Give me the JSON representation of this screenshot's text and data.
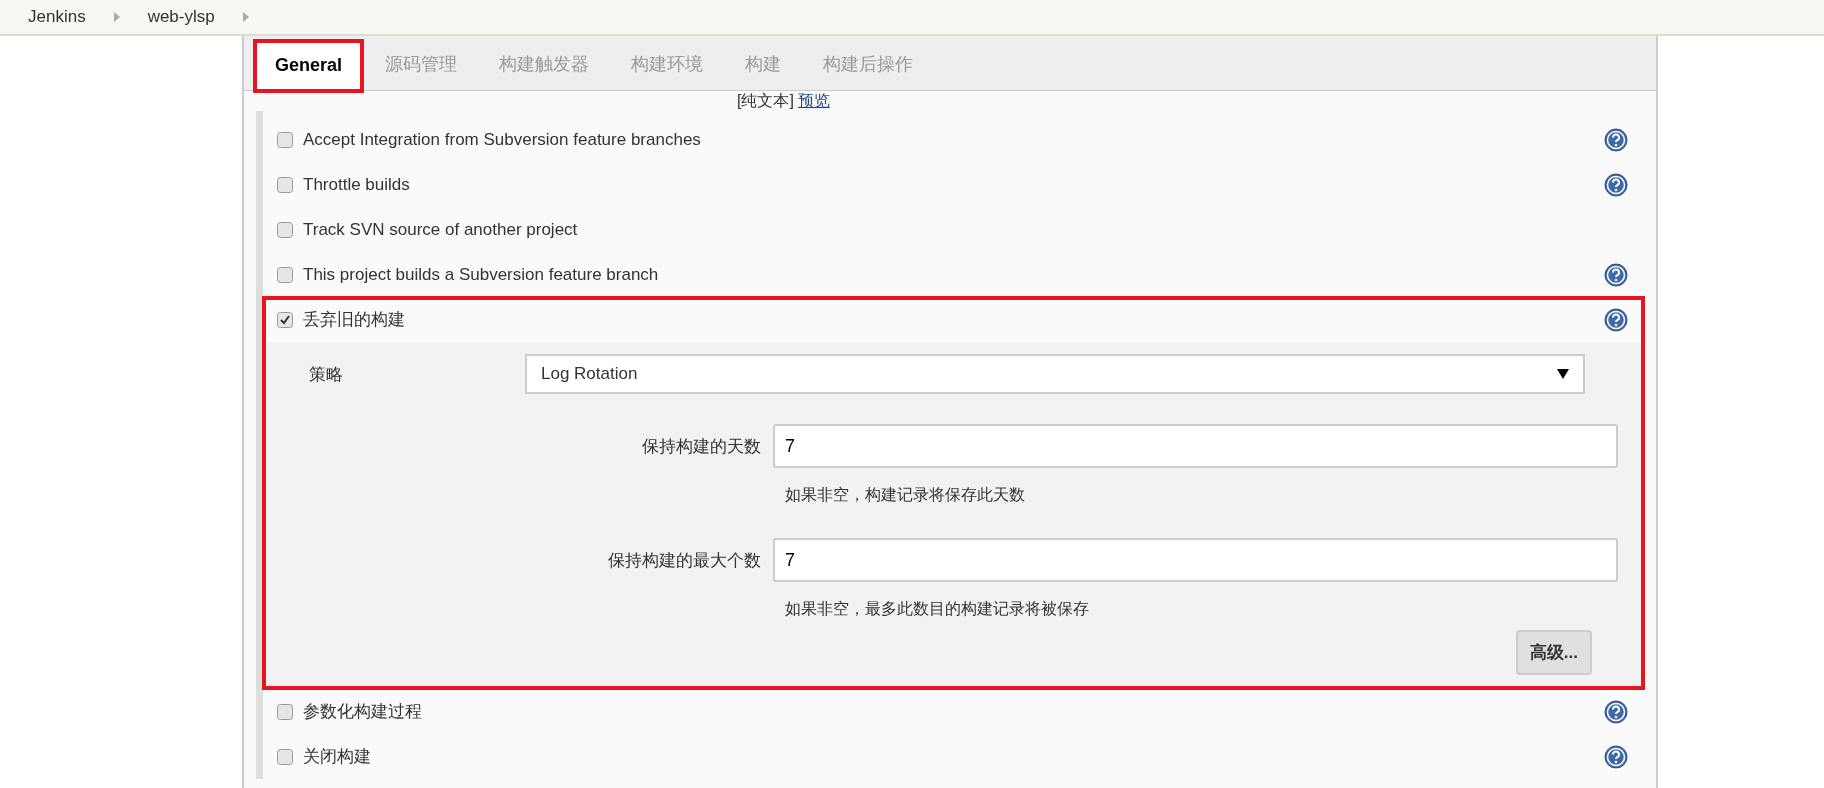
{
  "breadcrumbs": [
    "Jenkins",
    "web-ylsp"
  ],
  "tabs": [
    {
      "label": "General",
      "selected": true,
      "highlighted": true
    },
    {
      "label": "源码管理",
      "selected": false,
      "highlighted": false
    },
    {
      "label": "构建触发器",
      "selected": false,
      "highlighted": false
    },
    {
      "label": "构建环境",
      "selected": false,
      "highlighted": false
    },
    {
      "label": "构建",
      "selected": false,
      "highlighted": false
    },
    {
      "label": "构建后操作",
      "selected": false,
      "highlighted": false
    }
  ],
  "markup_line": {
    "text": "[纯文本]",
    "link": "预览"
  },
  "options": [
    {
      "label": "Accept Integration from Subversion feature branches",
      "checked": false,
      "help": true
    },
    {
      "label": "Throttle builds",
      "checked": false,
      "help": true
    },
    {
      "label": "Track SVN source of another project",
      "checked": false,
      "help": false
    },
    {
      "label": "This project builds a Subversion feature branch",
      "checked": false,
      "help": true
    },
    {
      "label": "丢弃旧的构建",
      "checked": true,
      "help": true,
      "highlighted": true,
      "strategy": {
        "label": "策略",
        "value": "Log Rotation"
      },
      "fields": [
        {
          "label": "保持构建的天数",
          "value": "7",
          "hint": "如果非空，构建记录将保存此天数"
        },
        {
          "label": "保持构建的最大个数",
          "value": "7",
          "hint": "如果非空，最多此数目的构建记录将被保存"
        }
      ],
      "button": "高级..."
    },
    {
      "label": "参数化构建过程",
      "checked": false,
      "help": true
    },
    {
      "label": "关闭构建",
      "checked": false,
      "help": true
    }
  ]
}
